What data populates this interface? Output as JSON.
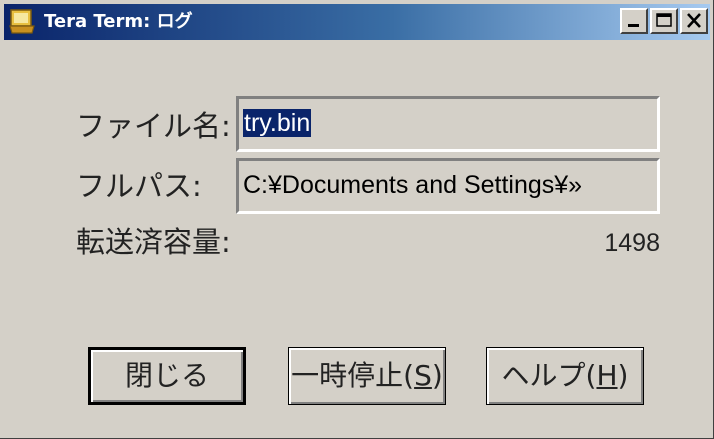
{
  "window": {
    "title": "Tera Term: ログ",
    "icon": "tera-term-icon",
    "controls": [
      "minimize-icon",
      "maximize-icon",
      "close-icon"
    ]
  },
  "dialog": {
    "filename_label": "ファイル名:",
    "filename_value": "try.bin",
    "fullpath_label": "フルパス:",
    "fullpath_value": "C:¥Documents and Settings¥»",
    "transferred_label": "転送済容量:",
    "transferred_value": "1498"
  },
  "buttons": {
    "close_label": "閉じる",
    "pause_label_prefix": "一時停止(",
    "pause_mnemonic": "S",
    "pause_label_suffix": ")",
    "help_label_prefix": "ヘルプ(",
    "help_mnemonic": "H",
    "help_label_suffix": ")"
  },
  "colors": {
    "titlebar_start": "#0a246a",
    "titlebar_end": "#a6caf0",
    "face": "#d4d0c8",
    "selection": "#0a246a"
  }
}
